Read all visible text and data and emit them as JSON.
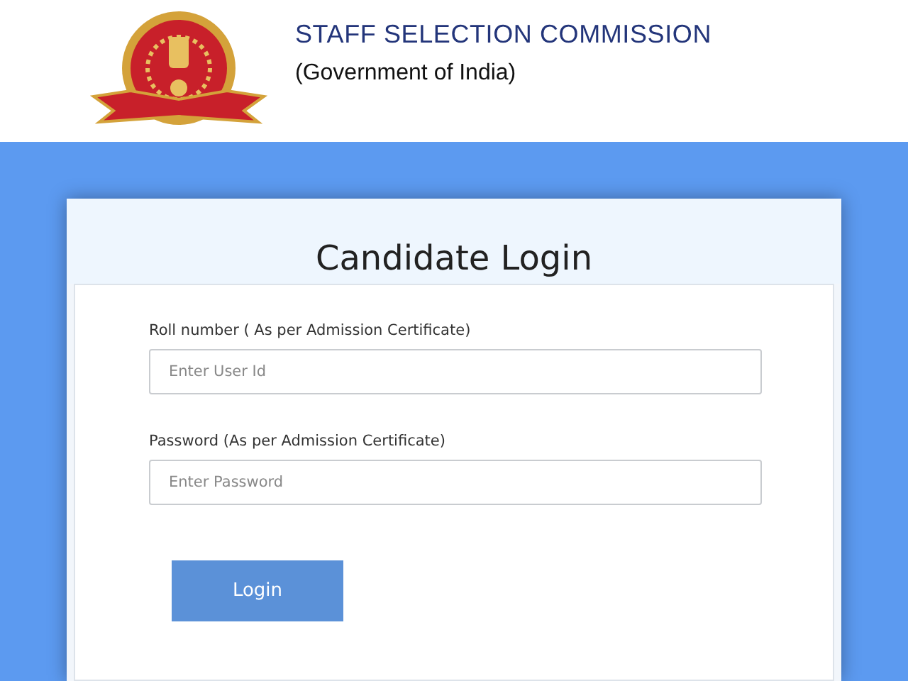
{
  "header": {
    "title": "STAFF SELECTION COMMISSION",
    "subtitle": "(Government of India)"
  },
  "login": {
    "title": "Candidate Login",
    "fields": [
      {
        "label": "Roll number ( As per Admission Certificate)",
        "placeholder": "Enter User Id"
      },
      {
        "label": "Password (As per Admission Certificate)",
        "placeholder": "Enter Password"
      }
    ],
    "button": "Login"
  }
}
